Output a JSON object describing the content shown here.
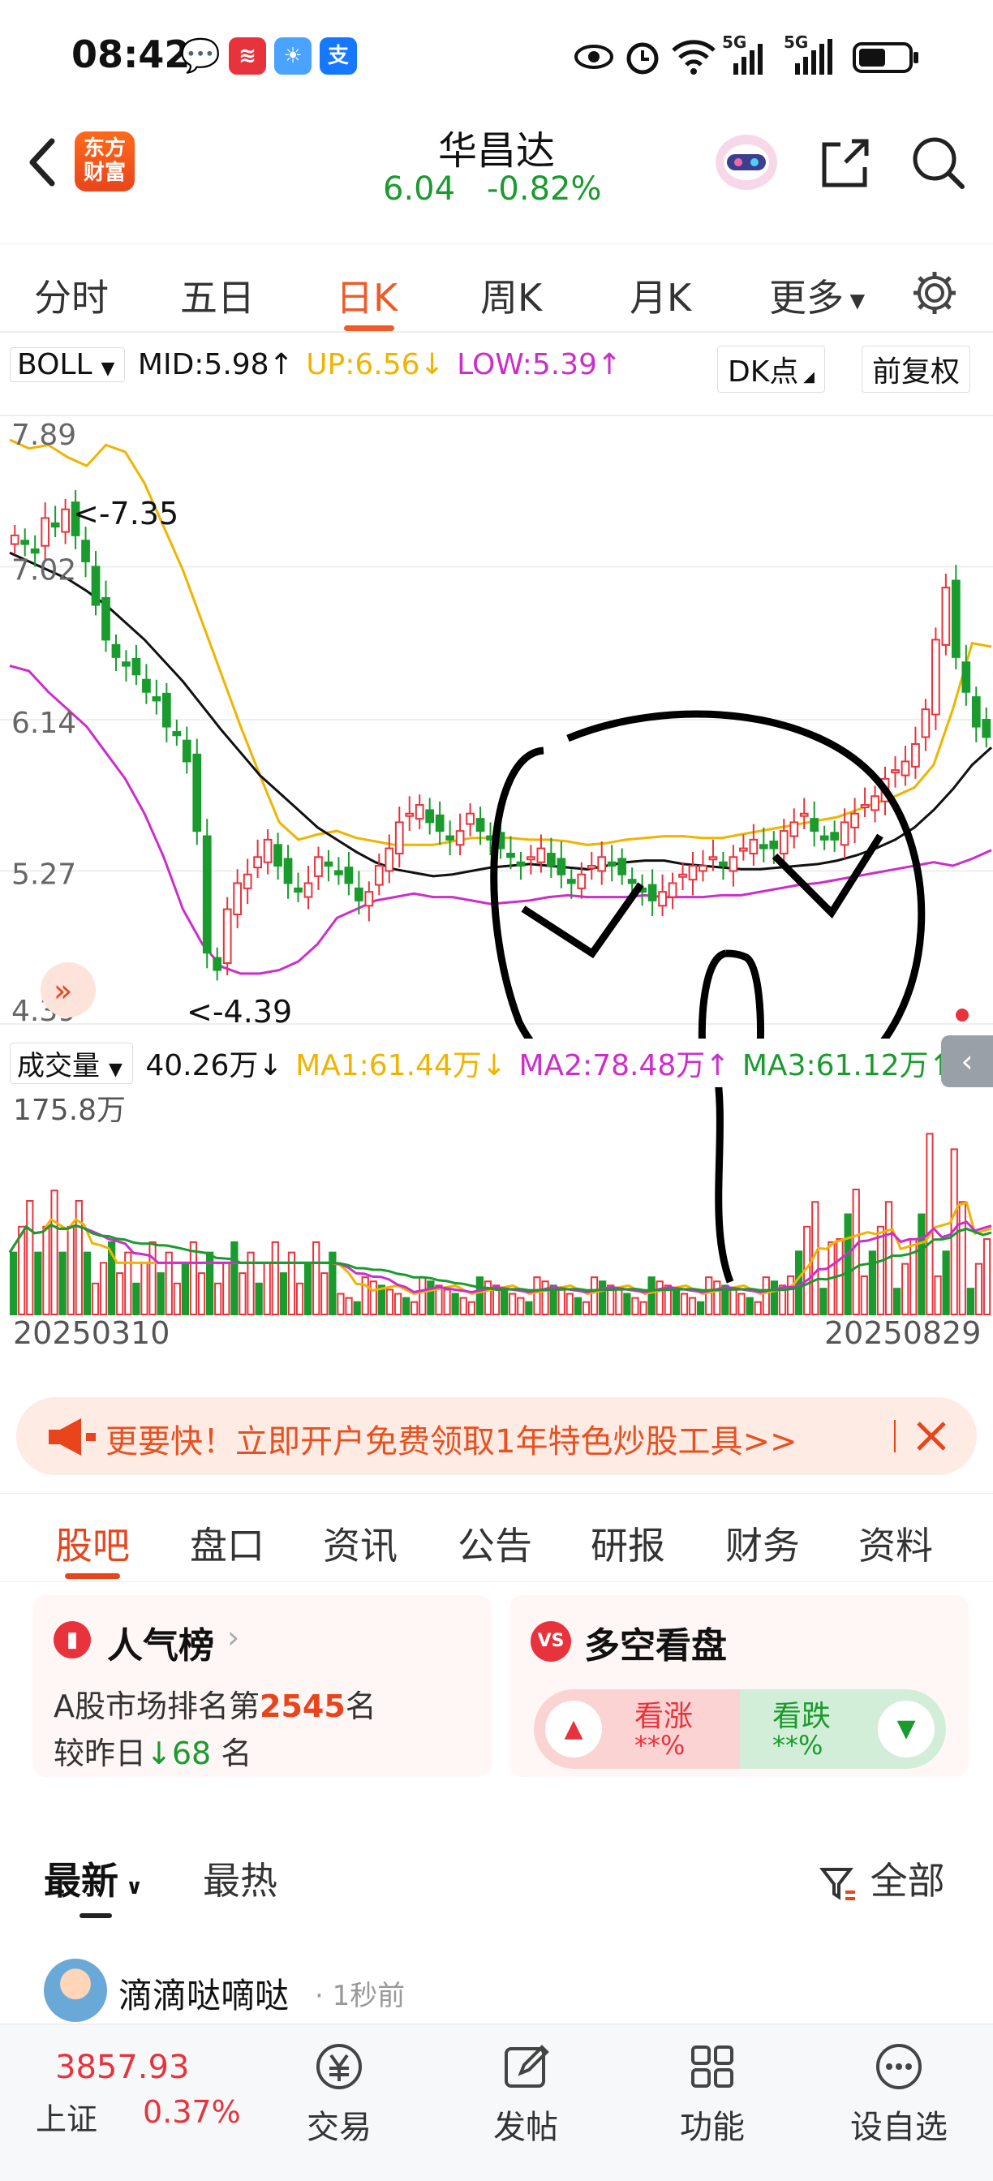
{
  "status_bar": {
    "time": "08:42",
    "net1": "5G",
    "net2": "5G"
  },
  "header": {
    "logo_line1": "东方",
    "logo_line2": "财富",
    "stock_name": "华昌达",
    "price": "6.04",
    "change_pct": "-0.82%"
  },
  "period_tabs": [
    "分时",
    "五日",
    "日K",
    "周K",
    "月K",
    "更多"
  ],
  "period_active_index": 2,
  "main_indicator": {
    "name": "BOLL",
    "mid": "MID:5.98↑",
    "up": "UP:6.56↓",
    "low": "LOW:5.39↑",
    "dk_button": "DK点",
    "adjust_button": "前复权"
  },
  "volume_indicator": {
    "name": "成交量",
    "volume": "40.26万↓",
    "ma1": "MA1:61.44万↓",
    "ma2": "MA2:78.48万↑",
    "ma3": "MA3:61.12万↑"
  },
  "colors": {
    "up": "#e8333c",
    "down": "#1a9b2e",
    "mid_line": "#111111",
    "up_band": "#f0b400",
    "low_band": "#cc2ecc",
    "ma1": "#f0b400",
    "ma2": "#cc2ecc",
    "ma3": "#1a9b2e",
    "accent": "#f05a28"
  },
  "chart_data": {
    "type": "candlestick",
    "y_ticks": [
      "7.89",
      "7.02",
      "6.14",
      "5.27",
      "4.39"
    ],
    "annotations": {
      "high": "<-7.35",
      "low": "<-4.39"
    },
    "volume_max_label": "175.8万",
    "x_labels": {
      "start": "20250310",
      "end": "20250829"
    },
    "close_series": [
      7.2,
      7.15,
      7.1,
      7.3,
      7.25,
      7.35,
      7.2,
      7.05,
      6.8,
      6.6,
      6.5,
      6.45,
      6.4,
      6.3,
      6.25,
      6.1,
      6.05,
      5.9,
      5.5,
      4.8,
      4.7,
      5.05,
      5.2,
      5.25,
      5.35,
      5.45,
      5.3,
      5.2,
      5.15,
      5.2,
      5.35,
      5.3,
      5.25,
      5.2,
      5.1,
      5.15,
      5.3,
      5.4,
      5.55,
      5.6,
      5.65,
      5.55,
      5.5,
      5.45,
      5.5,
      5.6,
      5.5,
      5.45,
      5.4,
      5.35,
      5.3,
      5.35,
      5.4,
      5.3,
      5.25,
      5.2,
      5.25,
      5.3,
      5.35,
      5.3,
      5.25,
      5.2,
      5.15,
      5.1,
      5.15,
      5.2,
      5.25,
      5.3,
      5.3,
      5.35,
      5.3,
      5.35,
      5.4,
      5.45,
      5.4,
      5.4,
      5.5,
      5.55,
      5.6,
      5.5,
      5.45,
      5.45,
      5.55,
      5.6,
      5.65,
      5.7,
      5.8,
      5.85,
      5.9,
      6.0,
      6.2,
      6.6,
      6.9,
      6.5,
      6.3,
      6.1,
      6.04
    ],
    "mid_series": [
      7.1,
      7.05,
      7.0,
      6.95,
      6.88,
      6.8,
      6.7,
      6.6,
      6.48,
      6.36,
      6.22,
      6.08,
      5.95,
      5.82,
      5.72,
      5.62,
      5.52,
      5.45,
      5.38,
      5.32,
      5.28,
      5.26,
      5.24,
      5.25,
      5.27,
      5.29,
      5.3,
      5.31,
      5.3,
      5.29,
      5.28,
      5.3,
      5.32,
      5.33,
      5.33,
      5.31,
      5.3,
      5.29,
      5.28,
      5.28,
      5.29,
      5.3,
      5.31,
      5.33,
      5.36,
      5.4,
      5.45,
      5.52,
      5.62,
      5.74,
      5.88,
      5.98
    ],
    "up_series": [
      7.75,
      7.7,
      7.72,
      7.65,
      7.6,
      7.72,
      7.68,
      7.5,
      7.25,
      7.0,
      6.7,
      6.4,
      6.1,
      5.82,
      5.55,
      5.45,
      5.48,
      5.5,
      5.46,
      5.44,
      5.42,
      5.42,
      5.42,
      5.44,
      5.46,
      5.46,
      5.46,
      5.45,
      5.45,
      5.44,
      5.42,
      5.43,
      5.45,
      5.46,
      5.47,
      5.47,
      5.46,
      5.46,
      5.48,
      5.5,
      5.52,
      5.54,
      5.56,
      5.58,
      5.62,
      5.66,
      5.7,
      5.75,
      5.88,
      6.2,
      6.58,
      6.56
    ],
    "low_series": [
      6.45,
      6.42,
      6.3,
      6.2,
      6.1,
      5.95,
      5.8,
      5.6,
      5.35,
      5.05,
      4.85,
      4.72,
      4.68,
      4.68,
      4.7,
      4.75,
      4.85,
      5.0,
      5.05,
      5.1,
      5.12,
      5.14,
      5.12,
      5.12,
      5.1,
      5.08,
      5.09,
      5.1,
      5.12,
      5.13,
      5.12,
      5.12,
      5.12,
      5.13,
      5.12,
      5.12,
      5.12,
      5.13,
      5.13,
      5.15,
      5.17,
      5.19,
      5.2,
      5.22,
      5.24,
      5.26,
      5.28,
      5.3,
      5.32,
      5.3,
      5.34,
      5.39
    ]
  },
  "promo": {
    "text": "更要快！立即开户免费领取1年特色炒股工具>>"
  },
  "section_tabs": [
    "股吧",
    "盘口",
    "资讯",
    "公告",
    "研报",
    "财务",
    "资料"
  ],
  "popularity_card": {
    "title": "人气榜",
    "rank_prefix": "A股市场排名第",
    "rank": "2545",
    "rank_suffix": "名",
    "compare_prefix": "较昨日",
    "compare_value": "68",
    "compare_suffix": "名"
  },
  "bull_bear_card": {
    "title": "多空看盘",
    "bull_label": "看涨",
    "bull_value": "**%",
    "bear_label": "看跌",
    "bear_value": "**%"
  },
  "feed_tabs": {
    "latest": "最新",
    "hot": "最热",
    "filter": "全部"
  },
  "post": {
    "author": "滴滴哒嘀哒",
    "time": "· 1秒前"
  },
  "bottom_nav": {
    "index_value": "3857.93",
    "index_name": "上证",
    "index_change": "0.37%",
    "items": [
      "交易",
      "发帖",
      "功能",
      "设自选"
    ]
  }
}
